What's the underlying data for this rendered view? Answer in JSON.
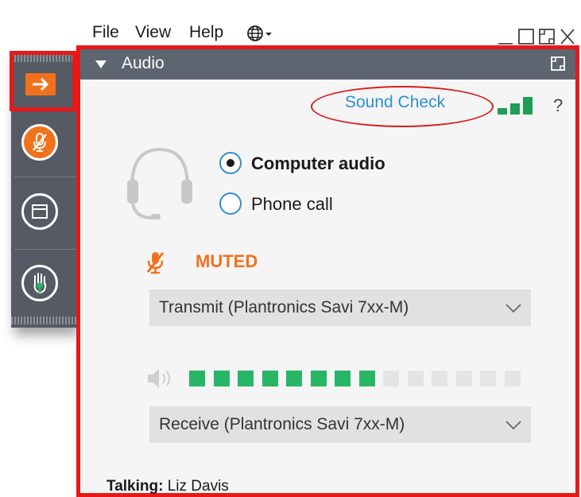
{
  "menu": {
    "file": "File",
    "view": "View",
    "help": "Help"
  },
  "panel": {
    "title": "Audio"
  },
  "sound_check": {
    "link": "Sound Check",
    "help": "?"
  },
  "audio_options": {
    "computer_audio": "Computer audio",
    "phone_call": "Phone call",
    "selected": "computer_audio"
  },
  "mic": {
    "status": "MUTED"
  },
  "transmit": {
    "device": "Transmit (Plantronics Savi 7xx-M)"
  },
  "speaker_level": {
    "active_segments": 8,
    "total_segments": 14
  },
  "receive": {
    "device": "Receive (Plantronics Savi 7xx-M)"
  },
  "talking": {
    "label": "Talking:",
    "name": "Liz Davis"
  },
  "colors": {
    "accent_red": "#e81818",
    "orange": "#f2711c",
    "blue": "#2f8fd0",
    "green": "#26b665",
    "header": "#5d6570"
  }
}
